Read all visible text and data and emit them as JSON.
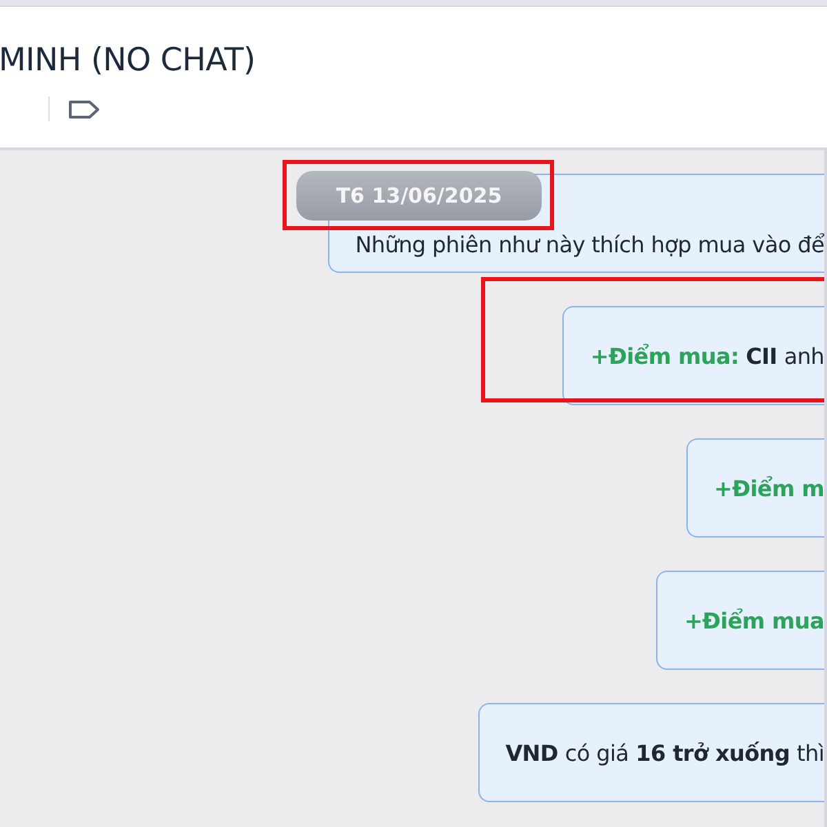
{
  "header": {
    "title": "MINH (NO CHAT)"
  },
  "date_divider": "T6 13/06/2025",
  "messages": [
    {
      "parts": [
        {
          "kind": "plain",
          "text": "Những phiên như này thích hợp mua vào để"
        }
      ]
    },
    {
      "parts": [
        {
          "kind": "accent",
          "text": "+Điểm mua:"
        },
        {
          "kind": "bold",
          "text": "CII"
        },
        {
          "kind": "plain",
          "text": "anh"
        }
      ]
    },
    {
      "parts": [
        {
          "kind": "accent",
          "text": "+Điểm m"
        }
      ]
    },
    {
      "parts": [
        {
          "kind": "accent",
          "text": "+Điểm mua"
        }
      ]
    },
    {
      "parts": [
        {
          "kind": "bold",
          "text": "VND"
        },
        {
          "kind": "plain",
          "text": "có giá"
        },
        {
          "kind": "bold",
          "text": "16 trở xuống"
        },
        {
          "kind": "plain",
          "text": "thì"
        }
      ]
    }
  ]
}
